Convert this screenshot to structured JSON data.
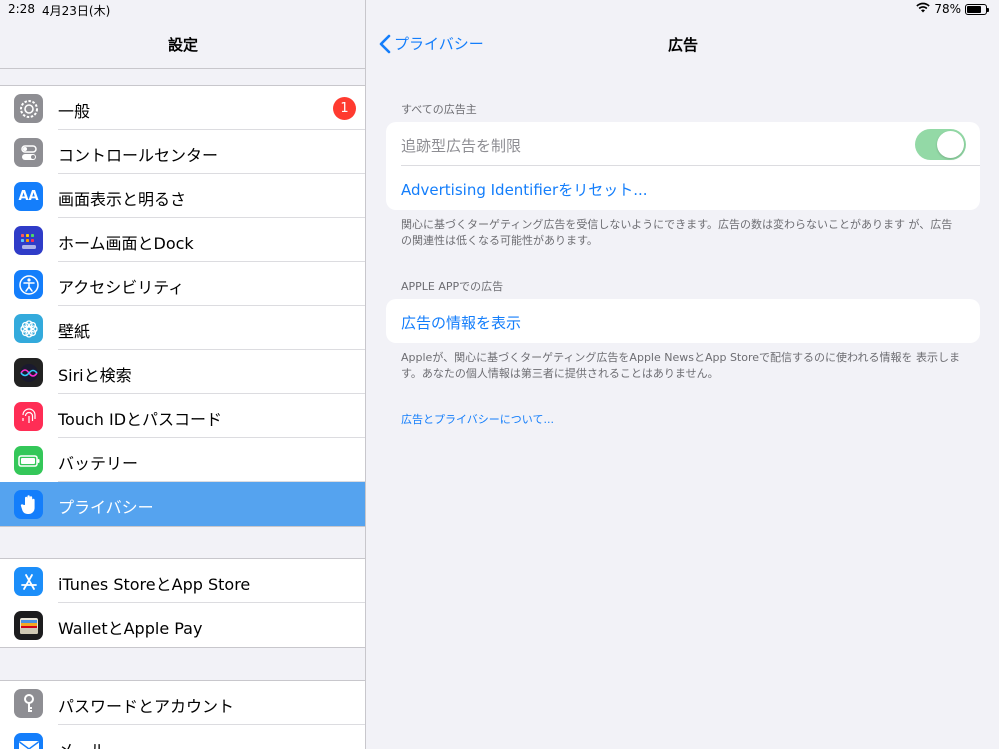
{
  "status_bar": {
    "time": "2:28",
    "date": "4月23日(木)",
    "battery_percent": "78%",
    "battery_level": 0.78
  },
  "sidebar": {
    "title": "設定",
    "groups": [
      {
        "items": [
          {
            "label": "一般",
            "icon": "gear-icon",
            "color": "#8e8e93",
            "badge": "1"
          },
          {
            "label": "コントロールセンター",
            "icon": "toggles-icon",
            "color": "#8e8e93"
          },
          {
            "label": "画面表示と明るさ",
            "icon": "text-size-icon",
            "color": "#147efb"
          },
          {
            "label": "ホーム画面とDock",
            "icon": "home-grid-icon",
            "color": "#2f3cc8"
          },
          {
            "label": "アクセシビリティ",
            "icon": "accessibility-icon",
            "color": "#147efb"
          },
          {
            "label": "壁紙",
            "icon": "flower-icon",
            "color": "#33aadc"
          },
          {
            "label": "Siriと検索",
            "icon": "siri-icon",
            "color": "#222222"
          },
          {
            "label": "Touch IDとパスコード",
            "icon": "fingerprint-icon",
            "color": "#ff2d55"
          },
          {
            "label": "バッテリー",
            "icon": "battery-icon",
            "color": "#34c759"
          },
          {
            "label": "プライバシー",
            "icon": "hand-icon",
            "color": "#147efb",
            "selected": true
          }
        ]
      },
      {
        "items": [
          {
            "label": "iTunes StoreとApp Store",
            "icon": "app-store-icon",
            "color": "#1c8ef9"
          },
          {
            "label": "WalletとApple Pay",
            "icon": "wallet-icon",
            "color": "#1c1c1e"
          }
        ]
      },
      {
        "items": [
          {
            "label": "パスワードとアカウント",
            "icon": "key-icon",
            "color": "#8e8e93"
          },
          {
            "label": "メール",
            "icon": "mail-icon",
            "color": "#147efb"
          }
        ]
      }
    ]
  },
  "detail": {
    "back_label": "プライバシー",
    "title": "広告",
    "section1_header": "すべての広告主",
    "limit_tracking_label": "追跡型広告を制限",
    "limit_tracking_on": true,
    "reset_label": "Advertising Identifierをリセット...",
    "section1_footer": "関心に基づくターゲティング広告を受信しないようにできます。広告の数は変わらないことがあります が、広告の関連性は低くなる可能性があります。",
    "section2_header": "APPLE APPでの広告",
    "view_ad_info_label": "広告の情報を表示",
    "section2_footer": "Appleが、関心に基づくターゲティング広告をApple NewsとApp Storeで配信するのに使われる情報を 表示します。あなたの個人情報は第三者に提供されることはありません。",
    "about_link": "広告とプライバシーについて..."
  }
}
